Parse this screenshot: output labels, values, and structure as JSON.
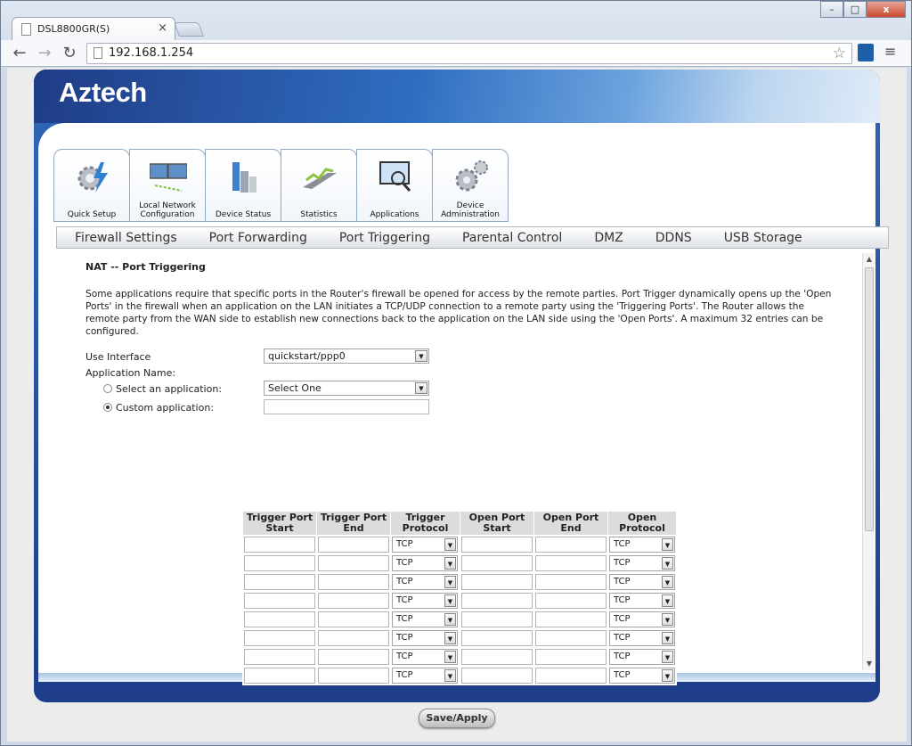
{
  "browser": {
    "tab_title": "DSL8800GR(S)",
    "close_glyph": "×",
    "url": "192.168.1.254",
    "min_glyph": "–",
    "max_glyph": "□",
    "close_win_glyph": "x"
  },
  "router": {
    "logo": "Aztech",
    "icon_tabs": [
      {
        "label": "Quick Setup",
        "icon": "gear-lightning-icon"
      },
      {
        "label": "Local Network Configuration",
        "icon": "monitors-icon"
      },
      {
        "label": "Device Status",
        "icon": "buildings-icon"
      },
      {
        "label": "Statistics",
        "icon": "chart-icon"
      },
      {
        "label": "Applications",
        "icon": "monitor-magnifier-icon"
      },
      {
        "label": "Device Administration",
        "icon": "gears-icon"
      }
    ],
    "subnav": [
      "Firewall Settings",
      "Port Forwarding",
      "Port Triggering",
      "Parental Control",
      "DMZ",
      "DDNS",
      "USB Storage"
    ]
  },
  "page": {
    "title": "NAT -- Port Triggering",
    "description": "Some applications require that specific ports in the Router's firewall be opened for access by the remote parties. Port Trigger dynamically opens up the 'Open Ports' in the firewall when an application on the LAN initiates a TCP/UDP connection to a remote party using the 'Triggering Ports'. The Router allows the remote party from the WAN side to establish new connections back to the application on the LAN side using the 'Open Ports'. A maximum 32 entries can be configured.",
    "use_interface_label": "Use Interface",
    "use_interface_value": "quickstart/ppp0",
    "app_name_label": "Application Name:",
    "select_app_label": "Select an application:",
    "select_app_value": "Select One",
    "custom_app_label": "Custom application:",
    "custom_app_value": "",
    "table": {
      "headers": [
        "Trigger Port Start",
        "Trigger Port End",
        "Trigger Protocol",
        "Open Port Start",
        "Open Port End",
        "Open Protocol"
      ],
      "rows": [
        {
          "trigger_protocol": "TCP",
          "open_protocol": "TCP"
        },
        {
          "trigger_protocol": "TCP",
          "open_protocol": "TCP"
        },
        {
          "trigger_protocol": "TCP",
          "open_protocol": "TCP"
        },
        {
          "trigger_protocol": "TCP",
          "open_protocol": "TCP"
        },
        {
          "trigger_protocol": "TCP",
          "open_protocol": "TCP"
        },
        {
          "trigger_protocol": "TCP",
          "open_protocol": "TCP"
        },
        {
          "trigger_protocol": "TCP",
          "open_protocol": "TCP"
        },
        {
          "trigger_protocol": "TCP",
          "open_protocol": "TCP"
        }
      ]
    },
    "save_button": "Save/Apply"
  },
  "colors": {
    "frame_blue": "#21387e",
    "accent_blue": "#2f6dc0"
  }
}
